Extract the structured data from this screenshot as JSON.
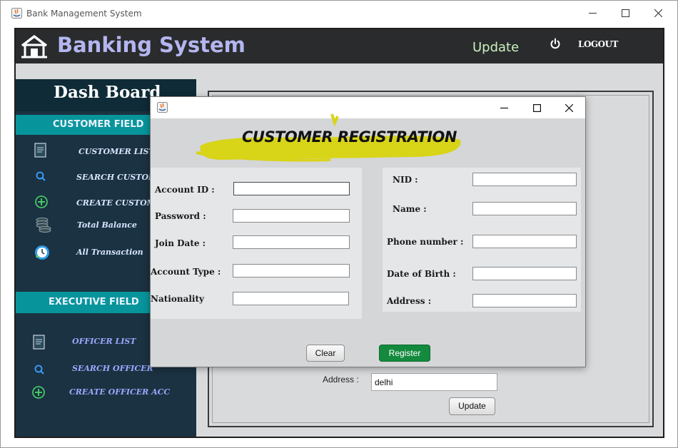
{
  "window": {
    "title": "Bank Management System",
    "controls": [
      "minimize-icon",
      "maximize-icon",
      "close-icon"
    ]
  },
  "header": {
    "app_title": "Banking System",
    "update_label": "Update",
    "logout_label": "LOGOUT",
    "colors": {
      "bar": "#2a2b2d",
      "title": "#b4b6f0",
      "update": "#c8f2c0"
    }
  },
  "sidebar": {
    "title": "Dash Board",
    "customer_section": "CUSTOMER FIELD",
    "customer_items": [
      {
        "label": "CUSTOMER LIST",
        "icon": "document-icon"
      },
      {
        "label": "SEARCH CUSTOMER",
        "icon": "search-icon"
      },
      {
        "label": "CREATE CUSTOMER",
        "icon": "plus-circle-icon"
      },
      {
        "label": "Total Balance",
        "icon": "coins-icon"
      },
      {
        "label": "All Transaction",
        "icon": "clock-icon"
      }
    ],
    "executive_section": "EXECUTIVE FIELD",
    "officer_items": [
      {
        "label": "OFFICER LIST",
        "icon": "document-icon"
      },
      {
        "label": "SEARCH OFFICER",
        "icon": "search-icon"
      },
      {
        "label": "CREATE OFFICER ACC",
        "icon": "plus-circle-icon"
      }
    ],
    "colors": {
      "band": "#07959b",
      "bg": "#1b3242"
    }
  },
  "main": {
    "address_label": "Address :",
    "address_value": "delhi",
    "update_button": "Update"
  },
  "dialog": {
    "title": "CUSTOMER REGISTRATION",
    "left_fields": [
      {
        "label": "Account ID :",
        "value": ""
      },
      {
        "label": "Password :",
        "value": ""
      },
      {
        "label": "Join Date :",
        "value": ""
      },
      {
        "label": "Account Type :",
        "value": ""
      },
      {
        "label": "Nationality",
        "value": ""
      }
    ],
    "right_fields": [
      {
        "label": "NID :",
        "value": ""
      },
      {
        "label": "Name :",
        "value": ""
      },
      {
        "label": "Phone number :",
        "value": ""
      },
      {
        "label": "Date of Birth :",
        "value": ""
      },
      {
        "label": "Address :",
        "value": ""
      }
    ],
    "clear_button": "Clear",
    "register_button": "Register",
    "colors": {
      "highlight": "#d8d418",
      "register": "#138a3e"
    }
  }
}
